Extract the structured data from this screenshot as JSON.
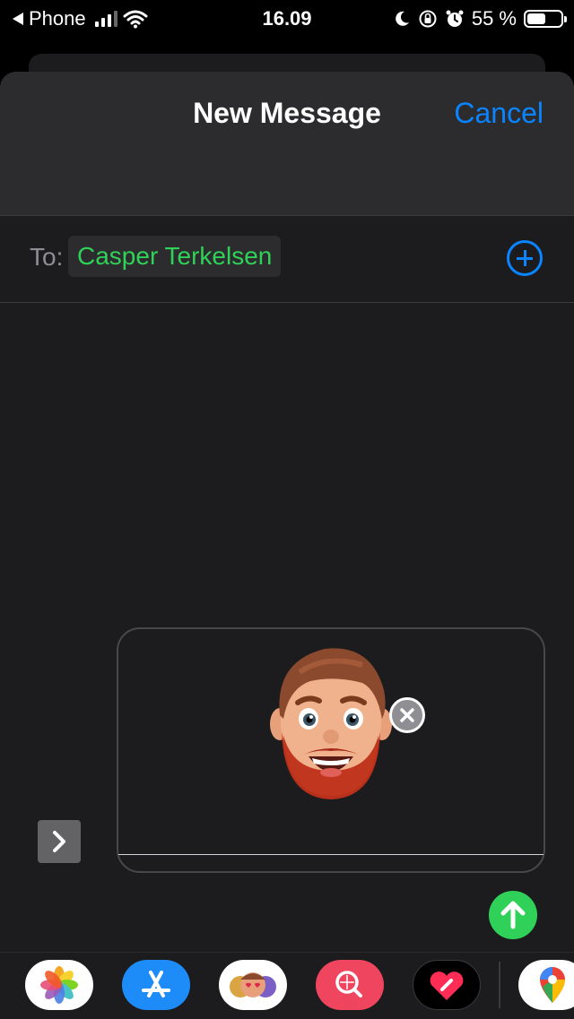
{
  "status_bar": {
    "back_app": "Phone",
    "time": "16.09",
    "battery_text": "55 %",
    "battery_level": 0.55
  },
  "header": {
    "title": "New Message",
    "cancel_label": "Cancel"
  },
  "to_field": {
    "label": "To:",
    "recipient": "Casper Terkelsen"
  },
  "compose": {
    "attachment": "memoji-sticker"
  },
  "app_tray": {
    "apps": [
      "photos-icon",
      "app-store-icon",
      "memoji-stickers-icon",
      "image-search-icon",
      "digital-touch-icon",
      "maps-icon"
    ]
  },
  "colors": {
    "accent": "#0a84ff",
    "recipient": "#30d158",
    "send": "#30d158",
    "background": "#1c1c1e"
  }
}
